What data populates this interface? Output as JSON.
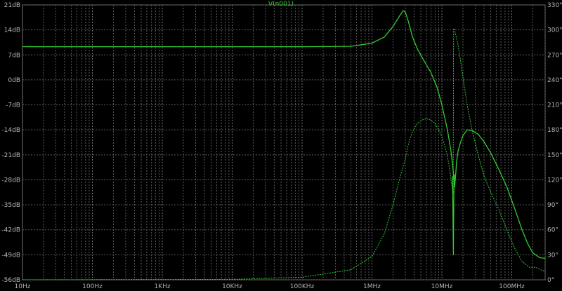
{
  "chart_data": {
    "type": "line",
    "title": "V(n001)",
    "xscale": "log",
    "xlim": [
      10,
      300000000
    ],
    "x_ticks": [
      {
        "value": 10,
        "label": "10Hz"
      },
      {
        "value": 100,
        "label": "100Hz"
      },
      {
        "value": 1000,
        "label": "1KHz"
      },
      {
        "value": 10000,
        "label": "10KHz"
      },
      {
        "value": 100000,
        "label": "100KHz"
      },
      {
        "value": 1000000,
        "label": "1MHz"
      },
      {
        "value": 10000000,
        "label": "10MHz"
      },
      {
        "value": 100000000,
        "label": "100MHz"
      }
    ],
    "ylim_left": [
      -56,
      21
    ],
    "y_left_ticks": [
      {
        "value": 21,
        "label": "21dB"
      },
      {
        "value": 14,
        "label": "14dB"
      },
      {
        "value": 7,
        "label": "7dB"
      },
      {
        "value": 0,
        "label": "0dB"
      },
      {
        "value": -7,
        "label": "-7dB"
      },
      {
        "value": -14,
        "label": "-14dB"
      },
      {
        "value": -21,
        "label": "-21dB"
      },
      {
        "value": -28,
        "label": "-28dB"
      },
      {
        "value": -35,
        "label": "-35dB"
      },
      {
        "value": -42,
        "label": "-42dB"
      },
      {
        "value": -49,
        "label": "-49dB"
      },
      {
        "value": -56,
        "label": "-56dB"
      }
    ],
    "ylim_right": [
      0,
      330
    ],
    "y_right_ticks": [
      {
        "value": 330,
        "label": "330°"
      },
      {
        "value": 300,
        "label": "300°"
      },
      {
        "value": 270,
        "label": "270°"
      },
      {
        "value": 240,
        "label": "240°"
      },
      {
        "value": 210,
        "label": "210°"
      },
      {
        "value": 180,
        "label": "180°"
      },
      {
        "value": 150,
        "label": "150°"
      },
      {
        "value": 120,
        "label": "120°"
      },
      {
        "value": 90,
        "label": "90°"
      },
      {
        "value": 60,
        "label": "60°"
      },
      {
        "value": 30,
        "label": "30°"
      },
      {
        "value": 0,
        "label": "0°"
      }
    ],
    "grid": true,
    "colors": {
      "background": "#000000",
      "trace": "#33cc33",
      "grid": "#5a5a5a",
      "tick_text": "#b4b4b4"
    },
    "series": [
      {
        "id": "magnitude",
        "axis": "left",
        "style": "solid",
        "x": [
          10,
          1000,
          100000,
          500000,
          1000000,
          1500000,
          2000000,
          2500000,
          2800000,
          3000000,
          3300000,
          3800000,
          4500000,
          5500000,
          7000000,
          8500000,
          10000000,
          12000000,
          13500000,
          14500000,
          15200000,
          15700000,
          16200000,
          17000000,
          18500000,
          20000000,
          23000000,
          27000000,
          33000000,
          40000000,
          50000000,
          65000000,
          85000000,
          110000000,
          140000000,
          170000000,
          200000000,
          250000000,
          300000000
        ],
        "y": [
          9.3,
          9.3,
          9.3,
          9.4,
          10.3,
          12.0,
          15.0,
          18.0,
          19.4,
          19.0,
          16.5,
          12.0,
          8.5,
          5.5,
          2.0,
          -2.0,
          -7.0,
          -14.0,
          -20.0,
          -25.5,
          -30.0,
          -27.0,
          -23.0,
          -20.0,
          -17.5,
          -15.6,
          -14.0,
          -14.2,
          -15.2,
          -17.3,
          -20.5,
          -25.0,
          -30.0,
          -36.0,
          -42.0,
          -46.0,
          -48.5,
          -49.8,
          -50.0
        ]
      },
      {
        "id": "magnitude-notch",
        "axis": "left",
        "style": "solid",
        "x": [
          14200000,
          14450000,
          14600000,
          14700000,
          14800000,
          14950000,
          15200000
        ],
        "y": [
          -27.0,
          -40.0,
          -49.0,
          -40.0,
          -33.0,
          -29.0,
          -26.5
        ]
      },
      {
        "id": "phase",
        "axis": "right",
        "style": "dashed",
        "x": [
          10,
          10000,
          100000,
          500000,
          1000000,
          1500000,
          2000000,
          2500000,
          3000000,
          3300000,
          3800000,
          4500000,
          5500000,
          6500000,
          8000000,
          10000000,
          11500000,
          12500000,
          13200000,
          13800000,
          14200000,
          14500000,
          14700000,
          15000000,
          16000000,
          17000000,
          18500000,
          20000000,
          23000000,
          27000000,
          33000000,
          40000000,
          50000000,
          65000000,
          85000000,
          110000000,
          140000000,
          180000000,
          220000000,
          260000000,
          300000000
        ],
        "y": [
          0,
          0.5,
          3,
          12,
          28,
          55,
          90,
          122,
          145,
          162,
          178,
          188,
          193,
          193,
          188,
          172,
          155,
          140,
          127,
          115,
          108,
          104,
          300,
          302,
          292,
          282,
          263,
          243,
          210,
          180,
          150,
          125,
          105,
          85,
          60,
          38,
          22,
          15,
          15,
          12,
          10
        ]
      }
    ]
  }
}
